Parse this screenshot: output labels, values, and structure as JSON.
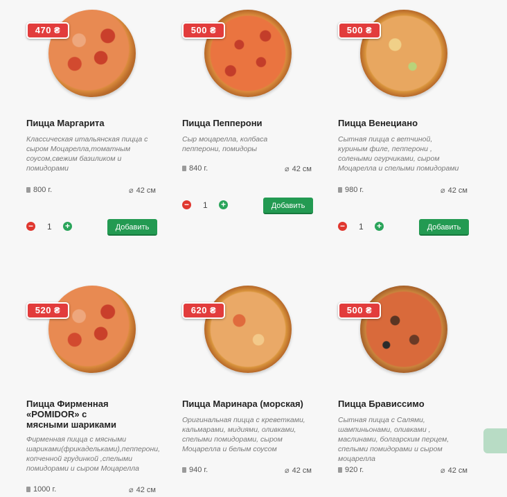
{
  "products": [
    {
      "price": "470 ₴",
      "title": "Пицца Маргарита",
      "desc": "Классическая итальянская пицца с сыром Моцарелла,томатным соусом,свежим базиликом и помидорами",
      "weight": "800 г.",
      "size": "42 см",
      "qty": "1",
      "button": "Добавить"
    },
    {
      "price": "500 ₴",
      "title": "Пицца Пепперони",
      "desc": "Сыр моцарелла, колбаса пепперони, помидоры",
      "weight": "840 г.",
      "size": "42 см",
      "qty": "1",
      "button": "Добавить"
    },
    {
      "price": "500 ₴",
      "title": "Пицца Венециано",
      "desc": "Сытная пицца с ветчиной, куриным филе, пепперони , солеными огурчиками, сыром Моцарелла и спелыми помидорами",
      "weight": "980 г.",
      "size": "42 см",
      "qty": "1",
      "button": "Добавить"
    },
    {
      "price": "520 ₴",
      "title": "Пицца Фирменная «POMIDOR» с мясными шариками",
      "desc": "Фирменная пицца с мясными шариками(фрикадельками),пепперони, копченной грудинкой ,спелыми помидорами и сыром Моцарелла",
      "weight": "1000 г.",
      "size": "42 см"
    },
    {
      "price": "620 ₴",
      "title": "Пицца Маринара (морская)",
      "desc": "Оригинальная пицца с креветками, кальмарами, мидиями, оливками, спелыми помидорами, сыром Моцарелла и белым соусом",
      "weight": "940 г.",
      "size": "42 см"
    },
    {
      "price": "500 ₴",
      "title": "Пицца Брависсимо",
      "desc": "Сытная пицца с Салями, шампиньонами, оливками , маслинами, болгарским перцем, спелыми помидорами и сыром моцарелла",
      "weight": "920 г.",
      "size": "42 см"
    }
  ],
  "icons": {
    "weight": "weight-icon",
    "size": "diameter-icon",
    "minus": "minus-icon",
    "plus": "plus-icon"
  },
  "colors": {
    "price_badge": "#e23c3c",
    "add_button": "#239a52",
    "minus": "#e0372f",
    "plus": "#2aa45a"
  }
}
